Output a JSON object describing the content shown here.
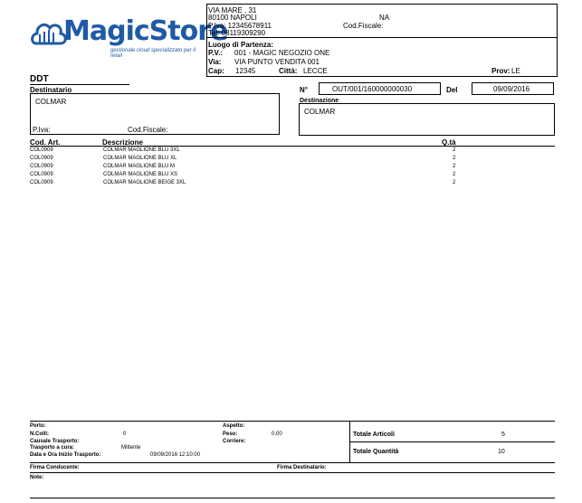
{
  "logo": {
    "name": "MagicStore",
    "tagline": "gestionale cloud specializzato per il retail"
  },
  "company": {
    "address": "VIA MARE , 31",
    "cap_city": "80100  NAPOLI",
    "province": "NA",
    "piva": "P.Iva:  12345678911",
    "cod_fiscale_label": "Cod.Fiscale:",
    "tel": "Tel: 08119309290"
  },
  "departure": {
    "title": "Luogo di Partenza:",
    "pv_label": "P.V.:",
    "pv_value": "001 - MAGIC NEGOZIO ONE",
    "via_label": "Via:",
    "via_value": "VIA PUNTO VENDITA 001",
    "cap_label": "Cap:",
    "cap_value": "12345",
    "city_label": "Città:",
    "city_value": "LECCE",
    "prov_label": "Prov:",
    "prov_value": "LE"
  },
  "doc": {
    "type": "DDT",
    "number_label": "N°",
    "number": "OUT/001/160000000030",
    "date_label": "Del",
    "date": "09/09/2016"
  },
  "recipient": {
    "title": "Destinatario",
    "name": "COLMAR",
    "piva_label": "P.Iva:",
    "cf_label": "Cod.Fiscale:"
  },
  "destination": {
    "title": "Destinazione",
    "name": "COLMAR"
  },
  "table": {
    "headers": {
      "code": "Cod. Art.",
      "desc": "Descrizione",
      "qty": "Q.tà"
    },
    "rows": [
      {
        "code": "COL0909",
        "desc": "COLMAR MAGLIONE BLU 3XL",
        "qty": "2"
      },
      {
        "code": "COL0909",
        "desc": "COLMAR MAGLIONE BLU XL",
        "qty": "2"
      },
      {
        "code": "COL0909",
        "desc": "COLMAR MAGLIONE BLU M",
        "qty": "2"
      },
      {
        "code": "COL0909",
        "desc": "COLMAR MAGLIONE BLU XS",
        "qty": "2"
      },
      {
        "code": "COL0909",
        "desc": "COLMAR MAGLIONE BEIGE 3XL",
        "qty": "2"
      }
    ]
  },
  "footer": {
    "porto_label": "Porto:",
    "colli_label": "N.Colli:",
    "colli_value": "0",
    "causale_label": "Causale Trasporto:",
    "cura_label": "Trasporto a cura:",
    "cura_value": "Mittente",
    "data_label": "Data e Ora Inizio Trasporto:",
    "data_value": "09/09/2016   12:10:00",
    "aspetto_label": "Aspetto:",
    "peso_label": "Peso:",
    "peso_value": "0,00",
    "corriere_label": "Corriere:",
    "tot_art_label": "Totale Articoli",
    "tot_art_value": "5",
    "tot_qty_label": "Totale Quantità",
    "tot_qty_value": "10",
    "firma_cond_label": "Firma Conducente:",
    "firma_dest_label": "Firma Destinatario:",
    "note_label": "Note:"
  }
}
